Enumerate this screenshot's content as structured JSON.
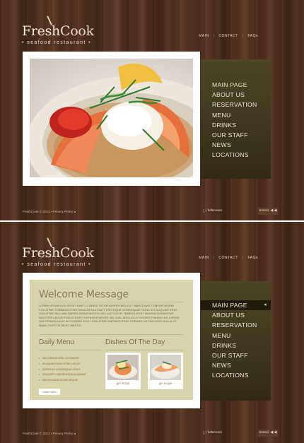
{
  "brand": {
    "name_a": "Fresh",
    "name_b": "Cook",
    "tagline": "• seafood restaurant •"
  },
  "top_nav": {
    "items": [
      "MAIN",
      "CONTACT",
      "FAQs"
    ],
    "separator": "|"
  },
  "main_menu": {
    "items": [
      "MAIN PAGE",
      "ABOUT US",
      "RESERVATION",
      "MENU",
      "DRINKS",
      "OUR STAFF",
      "NEWS",
      "LOCATIONS"
    ],
    "active_index_bottom": 0,
    "active_marker": "◂"
  },
  "footer": {
    "copyright": "FreshCook © 2012 • Privacy Policy ◂",
    "fullscreen": "| fullscreen",
    "sound": "sound: ◀ ◀"
  },
  "welcome": {
    "title": "Welcome Message",
    "body": "LOREM IPSUM DOLOR SIT AMET CONSECTETUR ADIPISCING ELIT MAECENAS TEMPOR MORBI VOLUTPAT COMMODO VESTIBULUM DUI EGET TRISTIQUE CONSEQUAT NUNC EU ALIQUAM ERAT VOLUTPAT NULLAM SAPIEN RISUS MATTIS VEL LUCTUS IN TEMPUS EGET MAGNA CURABITUR SAGITTIS LACUS PURUS EGET SAPIEN INTEGER VEL NISL MOLLIS ULTRICIES PHASELLUS LOREM NISI FRINGILLA AT ACCUMSAN EGET VOLUTPAT DAPIBUS ERAT CURABITUR FACILISIS NULLA UT NUNC PORTTITOR ET MATTIS"
  },
  "daily_menu": {
    "title": "Daily Menu",
    "items": [
      "ACCUMSAN NISL NONUMMY",
      "ALIQUAM DIAM VITAE LACUS",
      "EGESTAS CONSEQUAT ERAT",
      "SUSCIPIT LABORIOSUS ALIQUAM",
      "MALESUADA QUAM NEQUE"
    ],
    "more_label": "more more"
  },
  "dishes": {
    "title": "Dishes Of The Day",
    "items": [
      {
        "caption": "get recipe"
      },
      {
        "caption": "get recipe"
      }
    ]
  },
  "colors": {
    "wood": "#4e2f1e",
    "menu_bg": "#3d361d",
    "content_bg": "#d7d3ab",
    "accent_text": "#8a7a55"
  }
}
